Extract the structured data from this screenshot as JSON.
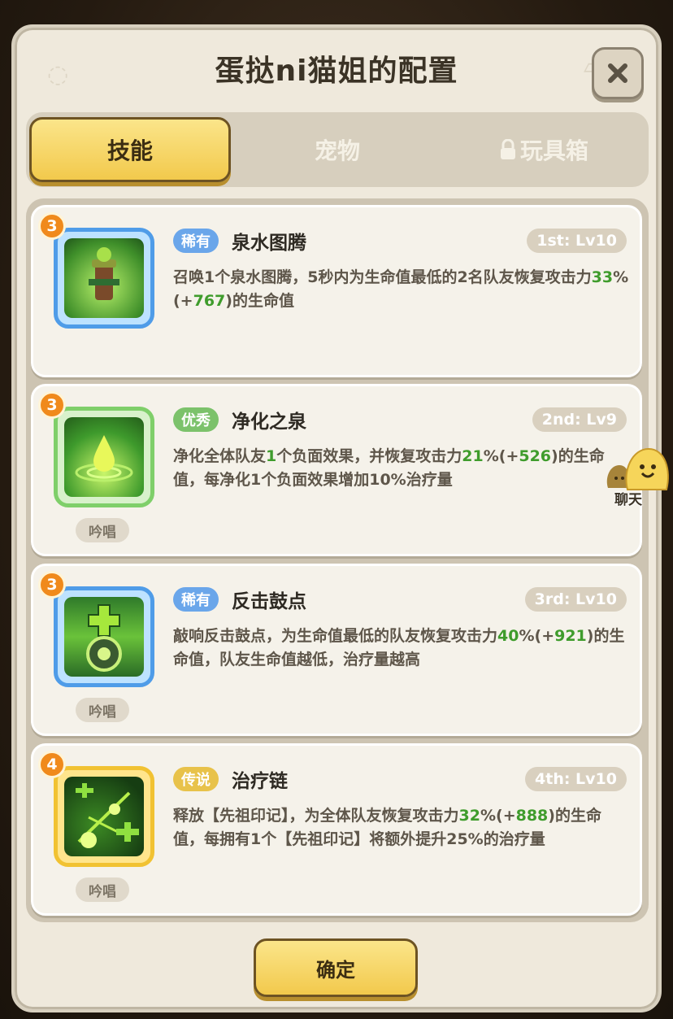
{
  "title": "蛋挞ni猫姐的配置",
  "tabs": [
    {
      "label": "技能",
      "active": true
    },
    {
      "label": "宠物",
      "active": false
    },
    {
      "label": "玩具箱",
      "active": false,
      "locked": true
    }
  ],
  "skills": [
    {
      "level_badge": "3",
      "rarity": "稀有",
      "name": "泉水图腾",
      "slot": "1st: Lv10",
      "desc_parts": [
        "召唤1个泉水图腾，5秒内为生命值最低的2名队友恢复攻击力",
        "33",
        "%(+",
        "767",
        ")的生命值"
      ],
      "chant": ""
    },
    {
      "level_badge": "3",
      "rarity": "优秀",
      "name": "净化之泉",
      "slot": "2nd: Lv9",
      "desc_parts": [
        "净化全体队友",
        "1",
        "个负面效果，并恢复攻击力",
        "21",
        "%(+",
        "526",
        ")的生命值，每净化1个负面效果增加10%治疗量"
      ],
      "chant": "吟唱"
    },
    {
      "level_badge": "3",
      "rarity": "稀有",
      "name": "反击鼓点",
      "slot": "3rd: Lv10",
      "desc_parts": [
        "敲响反击鼓点，为生命值最低的队友恢复攻击力",
        "40",
        "%(+",
        "921",
        ")的生命值，队友生命值越低，治疗量越高"
      ],
      "chant": "吟唱"
    },
    {
      "level_badge": "4",
      "rarity": "传说",
      "name": "治疗链",
      "slot": "4th: Lv10",
      "desc_parts": [
        "释放【先祖印记】，为全体队友恢复攻击力",
        "32",
        "%(+",
        "888",
        ")的生命值，每拥有1个【先祖印记】将额外提升25%的治疗量"
      ],
      "chant": "吟唱"
    }
  ],
  "chat_label": "聊天",
  "confirm_label": "确定",
  "colors": {
    "accent_yellow": "#f2c94c",
    "green_value": "#3f9c2c",
    "rare_blue": "#6aa6ea",
    "good_green": "#7cc26b",
    "legend_gold": "#e8c24a"
  },
  "icons": [
    "close-icon",
    "lock-icon",
    "totem-icon",
    "spring-icon",
    "drum-icon",
    "chain-icon",
    "chat-icon"
  ]
}
